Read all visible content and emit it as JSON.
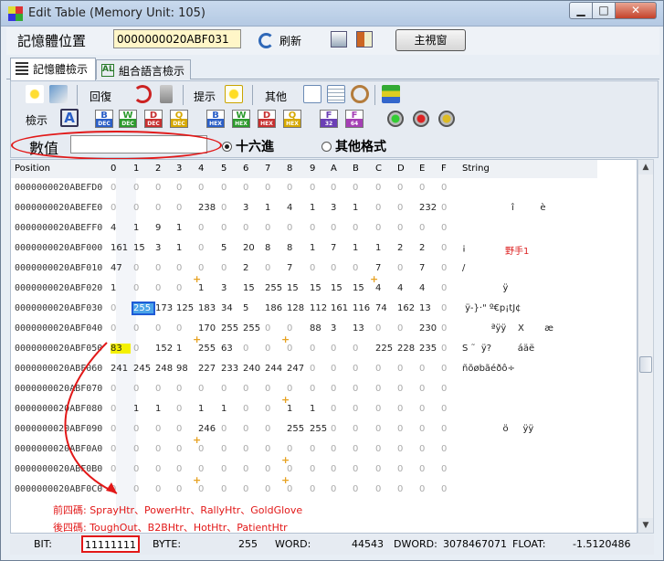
{
  "window": {
    "title": "Edit Table (Memory Unit: 105)",
    "min": "▁",
    "max": "□",
    "close": "✕"
  },
  "toolbar": {
    "address_label": "記憶體位置",
    "address_value": "0000000020ABF031",
    "refresh": "刷新",
    "main_window": "主視窗"
  },
  "tabs": [
    {
      "label": "記憶體檢示"
    },
    {
      "label": "組合語言檢示"
    }
  ],
  "panel": {
    "restore": "回復",
    "hint": "提示",
    "other": "其他",
    "view": "檢示",
    "value_label": "數值",
    "value_input": "",
    "radio_hex": "十六進",
    "radio_other": "其他格式"
  },
  "hex_icons": [
    {
      "top": "B",
      "bot": "DEC",
      "color": "#2b5fc7"
    },
    {
      "top": "W",
      "bot": "DEC",
      "color": "#2c9a2c"
    },
    {
      "top": "D",
      "bot": "DEC",
      "color": "#c73030"
    },
    {
      "top": "Q",
      "bot": "DEC",
      "color": "#d6a800"
    },
    {
      "top": "B",
      "bot": "HEX",
      "color": "#2b5fc7"
    },
    {
      "top": "W",
      "bot": "HEX",
      "color": "#2c9a2c"
    },
    {
      "top": "D",
      "bot": "HEX",
      "color": "#c73030"
    },
    {
      "top": "Q",
      "bot": "HEX",
      "color": "#d6a800"
    },
    {
      "top": "F",
      "bot": "32",
      "color": "#6b3fb5"
    },
    {
      "top": "F",
      "bot": "64",
      "color": "#a53fb5"
    }
  ],
  "grid": {
    "headers": [
      "Position",
      "0",
      "1",
      "2",
      "3",
      "4",
      "5",
      "6",
      "7",
      "8",
      "9",
      "A",
      "B",
      "C",
      "D",
      "E",
      "F",
      "String"
    ],
    "rows": [
      {
        "pos": "0000000020ABEFD0",
        "cells": [
          "0",
          "0",
          "0",
          "0",
          "0",
          "0",
          "0",
          "0",
          "0",
          "0",
          "0",
          "0",
          "0",
          "0",
          "0",
          "0"
        ],
        "str": ""
      },
      {
        "pos": "0000000020ABEFE0",
        "cells": [
          "0",
          "0",
          "0",
          "0",
          "238",
          "0",
          "3",
          "1",
          "4",
          "1",
          "3",
          "1",
          "0",
          "0",
          "232",
          "0"
        ],
        "str": "                 î         è"
      },
      {
        "pos": "0000000020ABEFF0",
        "cells": [
          "4",
          "1",
          "9",
          "1",
          "0",
          "0",
          "0",
          "0",
          "0",
          "0",
          "0",
          "0",
          "0",
          "0",
          "0",
          "0"
        ],
        "str": ""
      },
      {
        "pos": "0000000020ABF000",
        "cells": [
          "161",
          "15",
          "3",
          "1",
          "0",
          "5",
          "20",
          "8",
          "8",
          "1",
          "7",
          "1",
          "1",
          "2",
          "2",
          "0"
        ],
        "str": "¡"
      },
      {
        "pos": "0000000020ABF010",
        "cells": [
          "47",
          "0",
          "0",
          "0",
          "0",
          "0",
          "2",
          "0",
          "7",
          "0",
          "0",
          "0",
          "7",
          "0",
          "7",
          "0"
        ],
        "str": "/"
      },
      {
        "pos": "0000000020ABF020",
        "cells": [
          "1",
          "0",
          "0",
          "0",
          "1",
          "3",
          "15",
          "255",
          "15",
          "15",
          "15",
          "15",
          "4",
          "4",
          "4",
          "0"
        ],
        "str": "              ÿ"
      },
      {
        "pos": "0000000020ABF030",
        "cells": [
          "0",
          "255",
          "173",
          "125",
          "183",
          "34",
          "5",
          "186",
          "128",
          "112",
          "161",
          "116",
          "74",
          "162",
          "13",
          "0"
        ],
        "str": " ÿ-}·\" º€p¡tJ¢"
      },
      {
        "pos": "0000000020ABF040",
        "cells": [
          "0",
          "0",
          "0",
          "0",
          "170",
          "255",
          "255",
          "0",
          "0",
          "88",
          "3",
          "13",
          "0",
          "0",
          "230",
          "0"
        ],
        "str": "          ªÿÿ    X       æ"
      },
      {
        "pos": "0000000020ABF050",
        "cells": [
          "83",
          "0",
          "152",
          "1",
          "255",
          "63",
          "0",
          "0",
          "0",
          "0",
          "0",
          "0",
          "225",
          "228",
          "235",
          "0"
        ],
        "str": "S ˜  ÿ?         áäë"
      },
      {
        "pos": "0000000020ABF060",
        "cells": [
          "241",
          "245",
          "248",
          "98",
          "227",
          "233",
          "240",
          "244",
          "247",
          "0",
          "0",
          "0",
          "0",
          "0",
          "0",
          "0"
        ],
        "str": "ñõøbãéðô÷"
      },
      {
        "pos": "0000000020ABF070",
        "cells": [
          "0",
          "0",
          "0",
          "0",
          "0",
          "0",
          "0",
          "0",
          "0",
          "0",
          "0",
          "0",
          "0",
          "0",
          "0",
          "0"
        ],
        "str": ""
      },
      {
        "pos": "0000000020ABF080",
        "cells": [
          "0",
          "1",
          "1",
          "0",
          "1",
          "1",
          "0",
          "0",
          "1",
          "1",
          "0",
          "0",
          "0",
          "0",
          "0",
          "0"
        ],
        "str": ""
      },
      {
        "pos": "0000000020ABF090",
        "cells": [
          "0",
          "0",
          "0",
          "0",
          "246",
          "0",
          "0",
          "0",
          "255",
          "255",
          "0",
          "0",
          "0",
          "0",
          "0",
          "0"
        ],
        "str": "              ö     ÿÿ"
      },
      {
        "pos": "0000000020ABF0A0",
        "cells": [
          "0",
          "0",
          "0",
          "0",
          "0",
          "0",
          "0",
          "0",
          "0",
          "0",
          "0",
          "0",
          "0",
          "0",
          "0",
          "0"
        ],
        "str": ""
      },
      {
        "pos": "0000000020ABF0B0",
        "cells": [
          "0",
          "0",
          "0",
          "0",
          "0",
          "0",
          "0",
          "0",
          "0",
          "0",
          "0",
          "0",
          "0",
          "0",
          "0",
          "0"
        ],
        "str": ""
      },
      {
        "pos": "0000000020ABF0C0",
        "cells": [
          "0",
          "0",
          "0",
          "0",
          "0",
          "0",
          "0",
          "0",
          "0",
          "0",
          "0",
          "0",
          "0",
          "0",
          "0",
          "0"
        ],
        "str": ""
      }
    ],
    "annotation_red": "野手1",
    "note1": "前四碼: SprayHtr、PowerHtr、RallyHtr、GoldGlove",
    "note2": "後四碼: ToughOut、B2BHtr、HotHtr、PatientHtr"
  },
  "status": {
    "bit_label": "BIT:",
    "bit_value": "11111111",
    "byte_label": "BYTE:",
    "byte_value": "255",
    "word_label": "WORD:",
    "word_value": "44543",
    "dword_label": "DWORD:",
    "dword_value": "3078467071",
    "float_label": "FLOAT:",
    "float_value": "-1.5120486"
  },
  "colors": {
    "highlight_blue": "#4aa3e8",
    "highlight_yellow": "#f4f000",
    "annotation_red": "#e21818"
  }
}
